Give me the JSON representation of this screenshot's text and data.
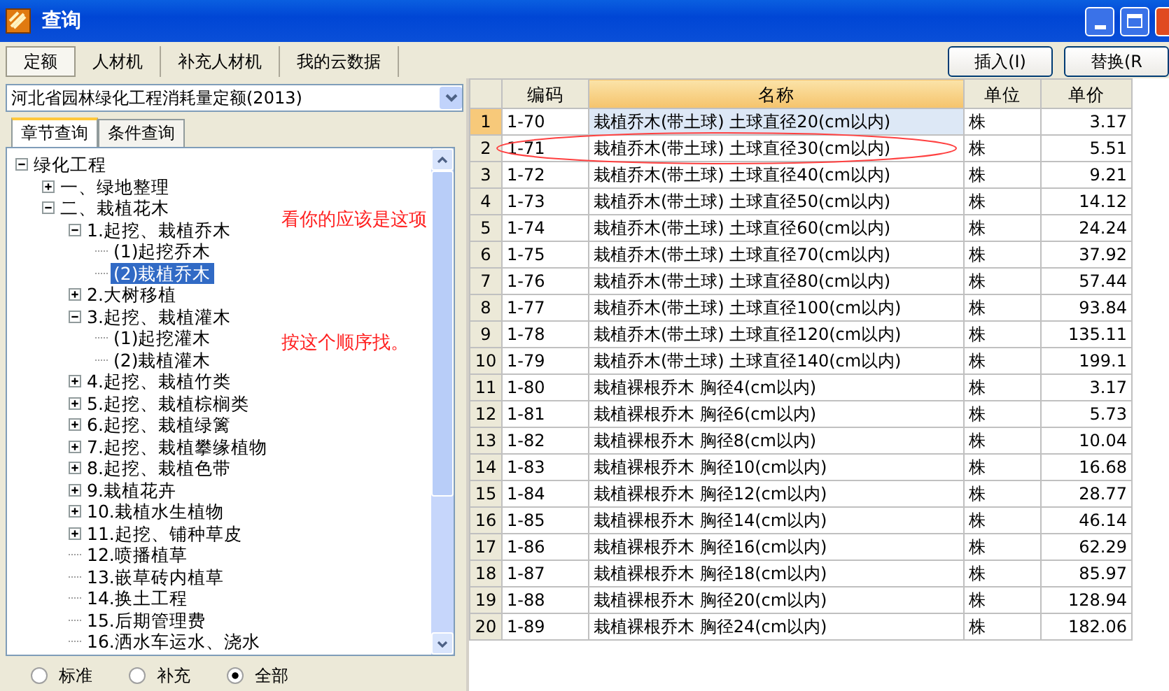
{
  "window": {
    "title": "查询"
  },
  "tabs": [
    {
      "label": "定额",
      "selected": true
    },
    {
      "label": "人材机",
      "selected": false
    },
    {
      "label": "补充人材机",
      "selected": false
    },
    {
      "label": "我的云数据",
      "selected": false
    }
  ],
  "buttons": [
    "插入(I)",
    "替换(R"
  ],
  "quota_select": {
    "value": "河北省园林绿化工程消耗量定额(2013)"
  },
  "subtabs": [
    {
      "label": "章节查询",
      "selected": true
    },
    {
      "label": "条件查询",
      "selected": false
    }
  ],
  "tree": [
    {
      "label": "绿化工程",
      "kind": "folder",
      "expanded": true,
      "selected": false,
      "children": [
        {
          "label": "一、绿地整理",
          "kind": "folder",
          "expanded": false,
          "selected": false
        },
        {
          "label": "二、栽植花木",
          "kind": "folder",
          "expanded": true,
          "selected": false,
          "children": [
            {
              "label": "1.起挖、栽植乔木",
              "kind": "folder",
              "expanded": true,
              "selected": false,
              "children": [
                {
                  "label": "(1)起挖乔木",
                  "kind": "leaf",
                  "selected": false
                },
                {
                  "label": "(2)栽植乔木",
                  "kind": "leaf",
                  "selected": true
                }
              ]
            },
            {
              "label": "2.大树移植",
              "kind": "folder",
              "expanded": false,
              "selected": false
            },
            {
              "label": "3.起挖、栽植灌木",
              "kind": "folder",
              "expanded": true,
              "selected": false,
              "children": [
                {
                  "label": "(1)起挖灌木",
                  "kind": "leaf",
                  "selected": false
                },
                {
                  "label": "(2)栽植灌木",
                  "kind": "leaf",
                  "selected": false
                }
              ]
            },
            {
              "label": "4.起挖、栽植竹类",
              "kind": "folder",
              "expanded": false,
              "selected": false
            },
            {
              "label": "5.起挖、栽植棕榈类",
              "kind": "folder",
              "expanded": false,
              "selected": false
            },
            {
              "label": "6.起挖、栽植绿篱",
              "kind": "folder",
              "expanded": false,
              "selected": false
            },
            {
              "label": "7.起挖、栽植攀缘植物",
              "kind": "folder",
              "expanded": false,
              "selected": false
            },
            {
              "label": "8.起挖、栽植色带",
              "kind": "folder",
              "expanded": false,
              "selected": false
            },
            {
              "label": "9.栽植花卉",
              "kind": "folder",
              "expanded": false,
              "selected": false
            },
            {
              "label": "10.栽植水生植物",
              "kind": "folder",
              "expanded": false,
              "selected": false
            },
            {
              "label": "11.起挖、铺种草皮",
              "kind": "folder",
              "expanded": false,
              "selected": false
            },
            {
              "label": "12.喷播植草",
              "kind": "leaf",
              "selected": false
            },
            {
              "label": "13.嵌草砖内植草",
              "kind": "leaf",
              "selected": false
            },
            {
              "label": "14.换土工程",
              "kind": "leaf",
              "selected": false
            },
            {
              "label": "15.后期管理费",
              "kind": "leaf",
              "selected": false
            },
            {
              "label": "16.洒水车运水、浇水",
              "kind": "leaf",
              "selected": false
            }
          ]
        }
      ]
    }
  ],
  "annotations": [
    "看你的应该是这项",
    "按这个顺序找。"
  ],
  "filter_options": [
    {
      "label": "标准",
      "selected": false
    },
    {
      "label": "补充",
      "selected": false
    },
    {
      "label": "全部",
      "selected": true
    }
  ],
  "table": {
    "columns": [
      "编码",
      "名称",
      "单位",
      "单价"
    ],
    "rows": [
      {
        "index": "1",
        "cells": [
          "1-70",
          "栽植乔木(带土球) 土球直径20(cm以内)",
          "株",
          "3.17"
        ],
        "selected": true
      },
      {
        "index": "2",
        "cells": [
          "1-71",
          "栽植乔木(带土球) 土球直径30(cm以内)",
          "株",
          "5.51"
        ],
        "selected": false
      },
      {
        "index": "3",
        "cells": [
          "1-72",
          "栽植乔木(带土球) 土球直径40(cm以内)",
          "株",
          "9.21"
        ],
        "selected": false
      },
      {
        "index": "4",
        "cells": [
          "1-73",
          "栽植乔木(带土球) 土球直径50(cm以内)",
          "株",
          "14.12"
        ],
        "selected": false
      },
      {
        "index": "5",
        "cells": [
          "1-74",
          "栽植乔木(带土球) 土球直径60(cm以内)",
          "株",
          "24.24"
        ],
        "selected": false
      },
      {
        "index": "6",
        "cells": [
          "1-75",
          "栽植乔木(带土球) 土球直径70(cm以内)",
          "株",
          "37.92"
        ],
        "selected": false
      },
      {
        "index": "7",
        "cells": [
          "1-76",
          "栽植乔木(带土球) 土球直径80(cm以内)",
          "株",
          "57.44"
        ],
        "selected": false
      },
      {
        "index": "8",
        "cells": [
          "1-77",
          "栽植乔木(带土球) 土球直径100(cm以内)",
          "株",
          "93.84"
        ],
        "selected": false
      },
      {
        "index": "9",
        "cells": [
          "1-78",
          "栽植乔木(带土球) 土球直径120(cm以内)",
          "株",
          "135.11"
        ],
        "selected": false
      },
      {
        "index": "10",
        "cells": [
          "1-79",
          "栽植乔木(带土球) 土球直径140(cm以内)",
          "株",
          "199.1"
        ],
        "selected": false
      },
      {
        "index": "11",
        "cells": [
          "1-80",
          "栽植裸根乔木 胸径4(cm以内)",
          "株",
          "3.17"
        ],
        "selected": false
      },
      {
        "index": "12",
        "cells": [
          "1-81",
          "栽植裸根乔木 胸径6(cm以内)",
          "株",
          "5.73"
        ],
        "selected": false
      },
      {
        "index": "13",
        "cells": [
          "1-82",
          "栽植裸根乔木 胸径8(cm以内)",
          "株",
          "10.04"
        ],
        "selected": false
      },
      {
        "index": "14",
        "cells": [
          "1-83",
          "栽植裸根乔木 胸径10(cm以内)",
          "株",
          "16.68"
        ],
        "selected": false
      },
      {
        "index": "15",
        "cells": [
          "1-84",
          "栽植裸根乔木 胸径12(cm以内)",
          "株",
          "28.77"
        ],
        "selected": false
      },
      {
        "index": "16",
        "cells": [
          "1-85",
          "栽植裸根乔木 胸径14(cm以内)",
          "株",
          "46.14"
        ],
        "selected": false
      },
      {
        "index": "17",
        "cells": [
          "1-86",
          "栽植裸根乔木 胸径16(cm以内)",
          "株",
          "62.29"
        ],
        "selected": false
      },
      {
        "index": "18",
        "cells": [
          "1-87",
          "栽植裸根乔木 胸径18(cm以内)",
          "株",
          "85.97"
        ],
        "selected": false
      },
      {
        "index": "19",
        "cells": [
          "1-88",
          "栽植裸根乔木 胸径20(cm以内)",
          "株",
          "128.94"
        ],
        "selected": false
      },
      {
        "index": "20",
        "cells": [
          "1-89",
          "栽植裸根乔木 胸径24(cm以内)",
          "株",
          "182.06"
        ],
        "selected": false
      }
    ]
  }
}
